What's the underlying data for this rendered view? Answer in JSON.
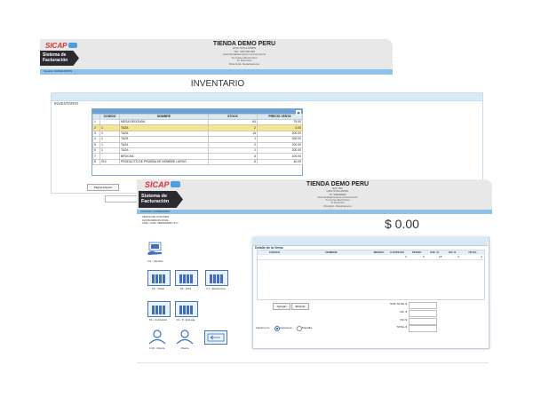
{
  "back": {
    "header": {
      "logo_text": "SICAP",
      "system_line1": "Sistema de",
      "system_line2": "Facturación",
      "store_name": "TIENDA DEMO PERU",
      "info_lines": [
        "LIMA-STAN-ADMIN",
        "TEL: 999 999 999",
        "www.tiendademoperu.com/comercio",
        "Tu Correo Electrónico",
        "Tu Dirección",
        "Rica Lima, Departamento"
      ],
      "user_line": "Usuario: SUPERADMIN"
    },
    "page_title": "INVENTARIO",
    "section_label": "INVENTARIO",
    "table": {
      "caption": "Inventario",
      "columns": [
        "CODIGO",
        "NOMBRE",
        "STOCK",
        "PRECIO VENTA"
      ],
      "rows": [
        {
          "n": "1",
          "code": "",
          "name": "MESA REDONDA",
          "stock": "84",
          "price": "75.00"
        },
        {
          "n": "2",
          "code": "1",
          "name": "TAZA",
          "stock": "2",
          "price": "0.00"
        },
        {
          "n": "3",
          "code": "1",
          "name": "TAZA",
          "stock": "14",
          "price": "200.00"
        },
        {
          "n": "4",
          "code": "1",
          "name": "TAZA",
          "stock": "1",
          "price": "200.00"
        },
        {
          "n": "5",
          "code": "1",
          "name": "TAZA",
          "stock": "2",
          "price": "200.00"
        },
        {
          "n": "6",
          "code": "1",
          "name": "TAZA",
          "stock": "1",
          "price": "200.00"
        },
        {
          "n": "7",
          "code": "",
          "name": "BROCHA",
          "stock": "8",
          "price": "100.00"
        },
        {
          "n": "8",
          "code": "010",
          "name": "PRODUCTO DE PRUEBA DE NOMBRE LARGO",
          "stock": "6",
          "price": "40.00"
        }
      ]
    },
    "prev_page_button": "Página Anterior"
  },
  "front": {
    "header": {
      "logo_text": "SICAP",
      "system_line1": "Sistema de",
      "system_line2": "Facturación",
      "store_name": "TIENDA DEMO PERU",
      "info_lines": [
        "RUC 000",
        "LIMA-STAN-ADMIN",
        "TF: 999999999",
        "www.tiendademoperu.com/comercio",
        "Tu Correo Electrónico",
        "Tu Dirección",
        "Municipio, Departamento"
      ],
      "user_line": "USUARIO: SUPERADMIN"
    },
    "customer_lines": [
      "VENTA DE CONTADO",
      "CONSUMIDOR FINAL",
      "LIMA, LIMA, DEMOPERU S.C."
    ],
    "total_display": "$ 0.00",
    "tiles": [
      {
        "label": "F2 - Clientes"
      },
      {
        "label": "F6 - Ticket"
      },
      {
        "label": "F8 - POS"
      },
      {
        "label": "F7 - Electronica"
      },
      {
        "label": "F9 - Cotización"
      },
      {
        "label": "F4 - Ti. Entrega"
      },
      {
        "label": "F10 - Cliente"
      },
      {
        "label": "Cliente"
      },
      {
        "label": ""
      }
    ],
    "sale": {
      "title": "Detalle de la Venta",
      "columns": [
        "CODIGO",
        "NOMBRE",
        "MEDIDA",
        "CANTIDAD",
        "PESOS",
        "%IS. %",
        "ISC %",
        "TOTAL"
      ],
      "row": [
        "",
        "",
        "",
        "0",
        "0",
        "18",
        "0",
        "0"
      ],
      "agregar": "Agregar",
      "eliminar": "Eliminar",
      "totals_labels": [
        "SUB-TOTAL $",
        "IVA. $",
        "ISC $",
        "TOTAL $"
      ],
      "print_label": "Imprimir en:",
      "radio1": "Impresora",
      "radio2": "Pantalla"
    }
  }
}
